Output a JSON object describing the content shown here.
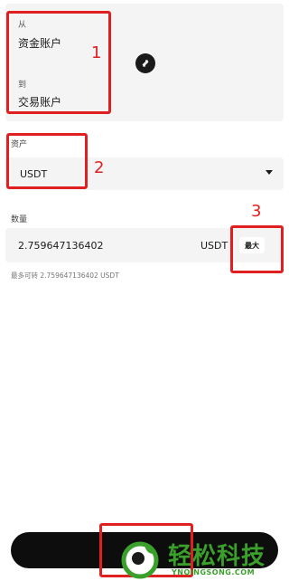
{
  "transfer": {
    "from_label": "从",
    "from_account": "资金账户",
    "to_label": "到",
    "to_account": "交易账户",
    "swap_icon": "swap-arrows-icon"
  },
  "asset": {
    "label": "资产",
    "selected": "USDT",
    "dropdown_icon": "chevron-down-icon"
  },
  "amount": {
    "label": "数量",
    "value": "2.759647136402",
    "unit": "USDT",
    "max_label": "最大",
    "available_text": "最多可转 2.759647136402 USDT"
  },
  "annotations": [
    "1",
    "2",
    "3"
  ],
  "annotation_color": "#e02020",
  "watermark": {
    "text": "轻松科技",
    "sub": "YNQINGSONG.COM",
    "color": "#3aa02b"
  }
}
